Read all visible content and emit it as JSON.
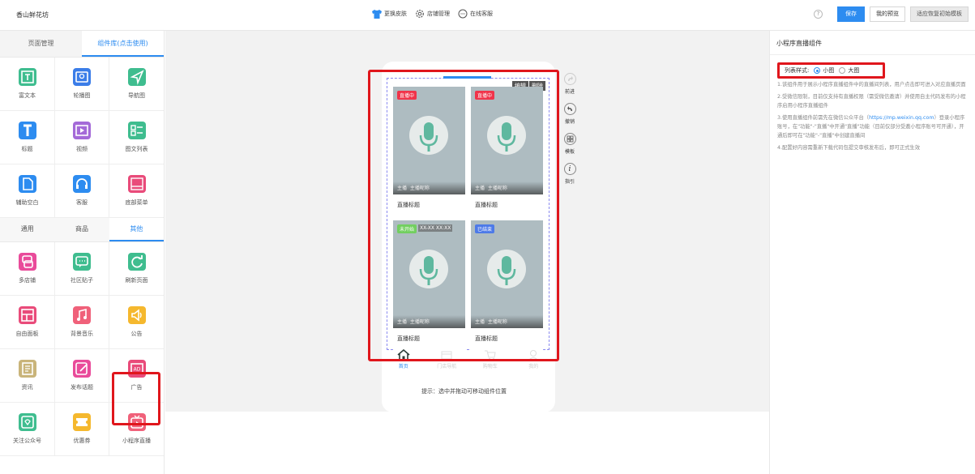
{
  "topbar": {
    "shop_name": "香山鲜花坊",
    "center_items": [
      "更换皮肤",
      "店铺管理",
      "在线客服"
    ],
    "help": "?",
    "save": "保存",
    "preview": "我的预览",
    "reset": "适应恢复初始模板"
  },
  "left": {
    "tab_pages": "页面管理",
    "tab_components": "组件库(点击使用)",
    "basic": [
      {
        "label": "富文本",
        "icon": "rich-text-icon",
        "color": "#3fbd8f"
      },
      {
        "label": "轮播图",
        "icon": "carousel-icon",
        "color": "#3b7de8"
      },
      {
        "label": "导航图",
        "icon": "navigation-icon",
        "color": "#3fbd8f"
      },
      {
        "label": "标题",
        "icon": "title-icon",
        "color": "#2d8cf0"
      },
      {
        "label": "视频",
        "icon": "video-icon",
        "color": "#a46ad8"
      },
      {
        "label": "图文列表",
        "icon": "image-list-icon",
        "color": "#3fbd8f"
      },
      {
        "label": "辅助空白",
        "icon": "blank-icon",
        "color": "#2d8cf0"
      },
      {
        "label": "客服",
        "icon": "headset-icon",
        "color": "#2d8cf0"
      },
      {
        "label": "底部菜单",
        "icon": "bottom-menu-icon",
        "color": "#e94b7a"
      }
    ],
    "tab_general": "通用",
    "tab_goods": "商品",
    "tab_other": "其他",
    "other": [
      {
        "label": "多店铺",
        "icon": "multi-store-icon",
        "color": "#e94b9a"
      },
      {
        "label": "社区贴子",
        "icon": "community-icon",
        "color": "#3fbd8f"
      },
      {
        "label": "刷新页面",
        "icon": "refresh-icon",
        "color": "#3fbd8f"
      },
      {
        "label": "自由面板",
        "icon": "free-panel-icon",
        "color": "#e94b7a"
      },
      {
        "label": "背景音乐",
        "icon": "music-icon",
        "color": "#f0617a"
      },
      {
        "label": "公告",
        "icon": "announcement-icon",
        "color": "#f5b82e"
      },
      {
        "label": "资讯",
        "icon": "news-icon",
        "color": "#c9b47a"
      },
      {
        "label": "发布话题",
        "icon": "edit-topic-icon",
        "color": "#e94b9a"
      },
      {
        "label": "广告",
        "icon": "ad-icon",
        "color": "#e94b7a"
      },
      {
        "label": "关注公众号",
        "icon": "follow-icon",
        "color": "#3fbd8f"
      },
      {
        "label": "优惠券",
        "icon": "coupon-icon",
        "color": "#f5b82e"
      },
      {
        "label": "小程序直播",
        "icon": "live-icon",
        "color": "#f0617a"
      }
    ]
  },
  "canvas": {
    "edit": "编辑",
    "delete": "删除",
    "cards": [
      {
        "status": "直播中",
        "host": "主播",
        "host_name": "主播昵称",
        "title": "直播标题",
        "time": ""
      },
      {
        "status": "直播中",
        "host": "主播",
        "host_name": "主播昵称",
        "title": "直播标题",
        "time": ""
      },
      {
        "status": "未开始",
        "host": "主播",
        "host_name": "主播昵称",
        "title": "直播标题",
        "time": "XX-XX XX:XX"
      },
      {
        "status": "已结束",
        "host": "主播",
        "host_name": "主播昵称",
        "title": "直播标题",
        "time": ""
      }
    ],
    "nav": [
      "首页",
      "门店导航",
      "购物车",
      "我的"
    ],
    "tools": [
      "前进",
      "撤销",
      "模板",
      "指引"
    ],
    "hint": "提示：选中并拖动可移动组件位置"
  },
  "right": {
    "title": "小程序直播组件",
    "style_label": "列表样式:",
    "opt_small": "小图",
    "opt_large": "大图",
    "note1": "1.该组件用于展示小程序直播组件中的直播间列表，用户点击即可进入对应直播页面",
    "note2": "2.受微信限制，目前仅支持有直播权限（需受微信邀请）并使用自主代码发布的小程序启用小程序直播组件",
    "note3a": "3.使用直播组件前需先在微信公众平台（",
    "note3_link": "https://mp.weixin.qq.com",
    "note3b": "）登录小程序账号，在\"功能\"-\"直播\"中开通\"直播\"功能（目前仅部分受邀小程序账号可开通），开通后即可在\"功能\"-\"直播\"中创建直播间",
    "note4": "4.配置好内容需重新下载代码包提交审核发布后，即可正式生效"
  }
}
